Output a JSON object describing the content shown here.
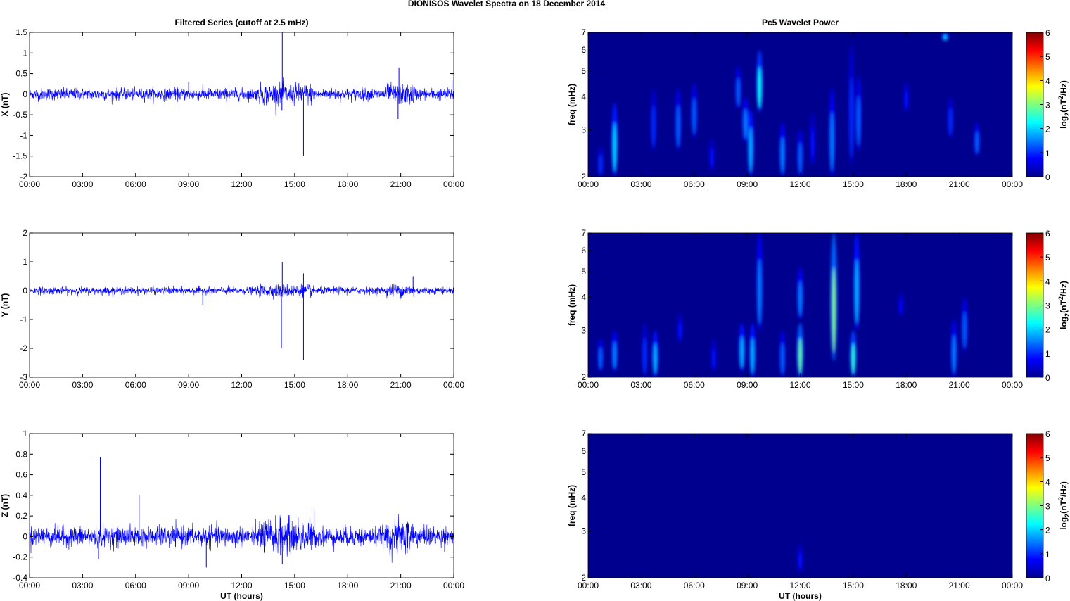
{
  "figure_title": "DIONISOS Wavelet Spectra on 18 December  2014",
  "chart_data": [
    {
      "type": "line",
      "panel": "X",
      "title": "Filtered Series (cutoff at 2.5 mHz)",
      "xlabel": "",
      "ylabel": "X (nT)",
      "ylim": [
        -2,
        1.5
      ],
      "yticks": [
        "1.5",
        "1",
        "0.5",
        "0",
        "-0.5",
        "-1",
        "-1.5",
        "-2"
      ],
      "xticks": [
        "00:00",
        "03:00",
        "06:00",
        "09:00",
        "12:00",
        "15:00",
        "18:00",
        "21:00",
        "00:00"
      ],
      "series_color": "#0000ff",
      "noise_amplitude": 0.09,
      "spikes": [
        {
          "t": 14.3,
          "v": 1.5
        },
        {
          "t": 14.28,
          "v": -0.4
        },
        {
          "t": 15.5,
          "v": -1.5
        },
        {
          "t": 20.9,
          "v": 0.65
        },
        {
          "t": 20.85,
          "v": -0.6
        },
        {
          "t": 9.0,
          "v": 0.3
        },
        {
          "t": 23.9,
          "v": 0.35
        }
      ]
    },
    {
      "type": "line",
      "panel": "Y",
      "title": "",
      "xlabel": "",
      "ylabel": "Y (nT)",
      "ylim": [
        -3,
        2
      ],
      "yticks": [
        "2",
        "1",
        "0",
        "-1",
        "-2",
        "-3"
      ],
      "xticks": [
        "00:00",
        "03:00",
        "06:00",
        "09:00",
        "12:00",
        "15:00",
        "18:00",
        "21:00",
        "00:00"
      ],
      "series_color": "#0000ff",
      "noise_amplitude": 0.08,
      "spikes": [
        {
          "t": 14.3,
          "v": 1.0
        },
        {
          "t": 14.25,
          "v": -2.0
        },
        {
          "t": 15.5,
          "v": 0.6
        },
        {
          "t": 15.5,
          "v": -2.4
        },
        {
          "t": 9.8,
          "v": -0.5
        },
        {
          "t": 21.7,
          "v": 0.5
        }
      ]
    },
    {
      "type": "line",
      "panel": "Z",
      "title": "",
      "xlabel": "UT (hours)",
      "ylabel": "Z (nT)",
      "ylim": [
        -0.4,
        1
      ],
      "yticks": [
        "1",
        "0.8",
        "0.6",
        "0.4",
        "0.2",
        "0",
        "-0.2",
        "-0.4"
      ],
      "xticks": [
        "00:00",
        "03:00",
        "06:00",
        "09:00",
        "12:00",
        "15:00",
        "18:00",
        "21:00",
        "00:00"
      ],
      "series_color": "#0000ff",
      "noise_amplitude": 0.06,
      "spikes": [
        {
          "t": 4.0,
          "v": 0.77
        },
        {
          "t": 6.2,
          "v": 0.4
        },
        {
          "t": 10.0,
          "v": -0.3
        },
        {
          "t": 14.3,
          "v": -0.27
        },
        {
          "t": 16.1,
          "v": 0.26
        },
        {
          "t": 3.9,
          "v": -0.22
        }
      ]
    },
    {
      "type": "heatmap",
      "panel": "X",
      "title": "Pc5 Wavelet Power",
      "xlabel": "",
      "ylabel": "freq (mHz)",
      "ylim": [
        2,
        7
      ],
      "yscale": "log",
      "yticks": [
        "2",
        "3",
        "4",
        "5",
        "6",
        "7"
      ],
      "xticks": [
        "00:00",
        "03:00",
        "06:00",
        "09:00",
        "12:00",
        "15:00",
        "18:00",
        "21:00",
        "00:00"
      ],
      "colorbar": {
        "label": "log2(nT2/Hz)",
        "label_main": "log",
        "label_sub": "2",
        "label_rest": "(nT",
        "label_sup": "2",
        "label_end": "/Hz)",
        "range": [
          0,
          6
        ],
        "ticks": [
          "6",
          "5",
          "4",
          "3",
          "2",
          "1",
          "0"
        ],
        "colormap": "jet"
      },
      "blobs": [
        [
          0.7,
          2.0,
          2.6,
          1.0
        ],
        [
          1.5,
          2.0,
          3.8,
          2.0
        ],
        [
          3.7,
          2.5,
          4.3,
          1.0
        ],
        [
          5.1,
          2.5,
          4.3,
          1.3
        ],
        [
          6.0,
          2.8,
          4.5,
          1.3
        ],
        [
          7.0,
          2.1,
          2.8,
          0.8
        ],
        [
          8.5,
          3.6,
          5.2,
          1.3
        ],
        [
          8.9,
          2.7,
          4.0,
          1.5
        ],
        [
          9.2,
          2.0,
          3.6,
          1.8
        ],
        [
          9.7,
          3.5,
          6.0,
          2.3
        ],
        [
          11.0,
          2.0,
          3.2,
          1.5
        ],
        [
          12.0,
          2.0,
          3.0,
          1.3
        ],
        [
          12.7,
          2.2,
          3.5,
          0.8
        ],
        [
          13.8,
          2.0,
          4.3,
          1.5
        ],
        [
          14.9,
          2.2,
          6.3,
          1.0
        ],
        [
          15.3,
          2.5,
          4.8,
          1.3
        ],
        [
          18.0,
          3.5,
          4.6,
          0.8
        ],
        [
          20.2,
          6.5,
          7.0,
          2.0
        ],
        [
          20.5,
          2.8,
          4.0,
          1.0
        ],
        [
          22.0,
          2.4,
          3.2,
          1.3
        ]
      ]
    },
    {
      "type": "heatmap",
      "panel": "Y",
      "title": "",
      "xlabel": "",
      "ylabel": "freq (mHz)",
      "ylim": [
        2,
        7
      ],
      "yscale": "log",
      "yticks": [
        "2",
        "3",
        "4",
        "5",
        "6",
        "7"
      ],
      "xticks": [
        "00:00",
        "03:00",
        "06:00",
        "09:00",
        "12:00",
        "15:00",
        "18:00",
        "21:00",
        "00:00"
      ],
      "colorbar": {
        "label": "log2(nT2/Hz)",
        "label_main": "log",
        "label_sub": "2",
        "label_rest": "(nT",
        "label_sup": "2",
        "label_end": "/Hz)",
        "range": [
          0,
          6
        ],
        "ticks": [
          "6",
          "5",
          "4",
          "3",
          "2",
          "1",
          "0"
        ],
        "colormap": "jet"
      },
      "blobs": [
        [
          0.7,
          2.1,
          2.8,
          1.3
        ],
        [
          1.5,
          2.1,
          3.0,
          1.5
        ],
        [
          3.2,
          2.0,
          3.2,
          1.0
        ],
        [
          3.8,
          2.0,
          3.0,
          1.8
        ],
        [
          5.2,
          2.7,
          3.5,
          0.8
        ],
        [
          7.1,
          2.1,
          2.8,
          0.8
        ],
        [
          8.7,
          2.1,
          3.2,
          1.8
        ],
        [
          9.3,
          2.0,
          3.2,
          1.8
        ],
        [
          9.7,
          3.0,
          7.0,
          1.5
        ],
        [
          11.0,
          2.0,
          3.0,
          1.3
        ],
        [
          12.0,
          2.0,
          3.2,
          2.8
        ],
        [
          12.0,
          3.3,
          5.2,
          1.5
        ],
        [
          13.9,
          2.3,
          7.0,
          3.0
        ],
        [
          15.0,
          2.0,
          3.0,
          2.5
        ],
        [
          15.2,
          3.0,
          7.0,
          1.8
        ],
        [
          17.7,
          3.4,
          4.2,
          0.7
        ],
        [
          20.7,
          2.0,
          3.3,
          1.5
        ],
        [
          21.3,
          2.5,
          4.0,
          1.3
        ]
      ]
    },
    {
      "type": "heatmap",
      "panel": "Z",
      "title": "",
      "xlabel": "UT (hours)",
      "ylabel": "freq (mHz)",
      "ylim": [
        2,
        7
      ],
      "yscale": "log",
      "yticks": [
        "2",
        "3",
        "4",
        "5",
        "6",
        "7"
      ],
      "xticks": [
        "00:00",
        "03:00",
        "06:00",
        "09:00",
        "12:00",
        "15:00",
        "18:00",
        "21:00",
        "00:00"
      ],
      "colorbar": {
        "label": "log2(nT2/Hz)",
        "label_main": "log",
        "label_sub": "2",
        "label_rest": "(nT",
        "label_sup": "2",
        "label_end": "/Hz)",
        "range": [
          0,
          6
        ],
        "ticks": [
          "6",
          "5",
          "4",
          "3",
          "2",
          "1",
          "0"
        ],
        "colormap": "jet"
      },
      "blobs": [
        [
          12.0,
          2.1,
          2.7,
          0.8
        ]
      ]
    }
  ]
}
